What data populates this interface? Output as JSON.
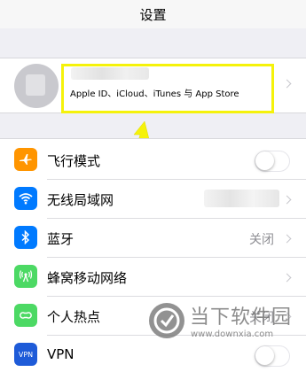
{
  "navbar": {
    "title": "设置"
  },
  "profile": {
    "subtitle": "Apple ID、iCloud、iTunes 与 App Store"
  },
  "settings": [
    {
      "label": "飞行模式",
      "icon": "airplane-icon",
      "color": "#ff9500",
      "value": "",
      "control": "toggle"
    },
    {
      "label": "无线局域网",
      "icon": "wifi-icon",
      "color": "#007aff",
      "value": "",
      "control": "chevron"
    },
    {
      "label": "蓝牙",
      "icon": "bluetooth-icon",
      "color": "#007aff",
      "value": "关闭",
      "control": "chevron"
    },
    {
      "label": "蜂窝移动网络",
      "icon": "cellular-icon",
      "color": "#4cd964",
      "value": "",
      "control": "chevron"
    },
    {
      "label": "个人热点",
      "icon": "hotspot-icon",
      "color": "#4cd964",
      "value": "关闭",
      "control": "chevron"
    },
    {
      "label": "VPN",
      "icon": "vpn-icon",
      "color": "#1e5bd8",
      "value": "",
      "control": "toggle"
    }
  ],
  "vpn_icon_text": "VPN",
  "watermark": {
    "text": "当下软件园",
    "url": "www.downxia.com"
  },
  "colors": {
    "highlight": "#f5f20a",
    "background": "#efeff4"
  }
}
